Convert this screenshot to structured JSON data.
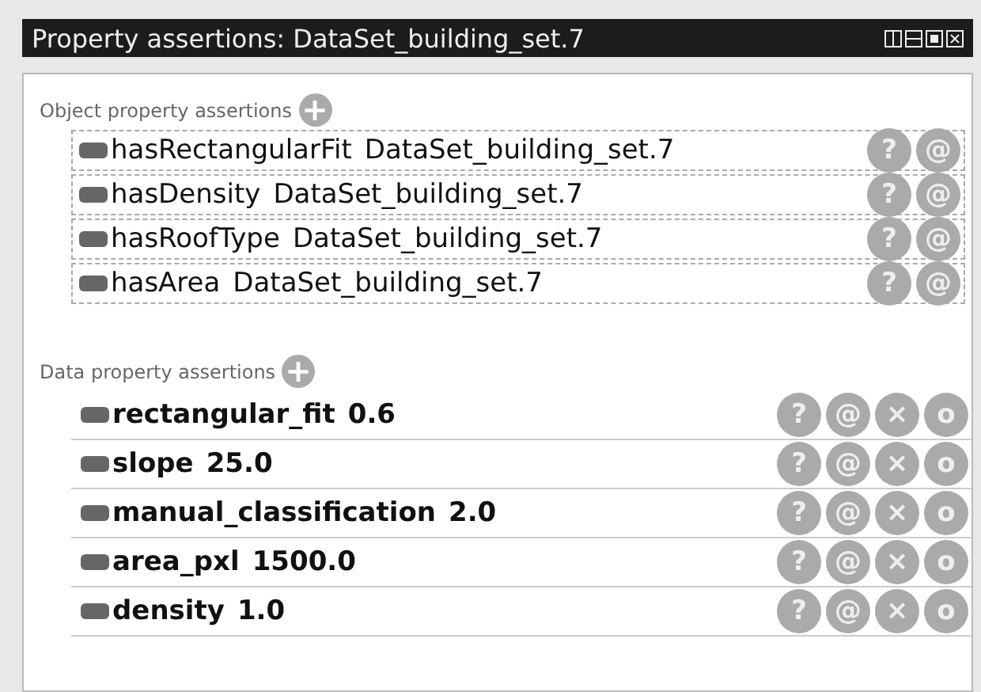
{
  "window": {
    "title": "Property assertions: DataSet_building_set.7"
  },
  "object_property_assertions": {
    "label": "Object property assertions",
    "add_button": "+",
    "rows": [
      {
        "property": "hasRectangularFit",
        "value": "DataSet_building_set.7",
        "buttons": [
          "?",
          "@"
        ]
      },
      {
        "property": "hasDensity",
        "value": "DataSet_building_set.7",
        "buttons": [
          "?",
          "@"
        ]
      },
      {
        "property": "hasRoofType",
        "value": "DataSet_building_set.7",
        "buttons": [
          "?",
          "@"
        ]
      },
      {
        "property": "hasArea",
        "value": "DataSet_building_set.7",
        "buttons": [
          "?",
          "@"
        ]
      }
    ]
  },
  "data_property_assertions": {
    "label": "Data property assertions",
    "add_button": "+",
    "rows": [
      {
        "property": "rectangular_fit",
        "value": "0.6",
        "buttons": [
          "?",
          "@",
          "×",
          "o"
        ]
      },
      {
        "property": "slope",
        "value": "25.0",
        "buttons": [
          "?",
          "@",
          "×",
          "o"
        ]
      },
      {
        "property": "manual_classification",
        "value": "2.0",
        "buttons": [
          "?",
          "@",
          "×",
          "o"
        ]
      },
      {
        "property": "area_pxl",
        "value": "1500.0",
        "buttons": [
          "?",
          "@",
          "×",
          "o"
        ]
      },
      {
        "property": "density",
        "value": "1.0",
        "buttons": [
          "?",
          "@",
          "×",
          "o"
        ]
      }
    ]
  }
}
